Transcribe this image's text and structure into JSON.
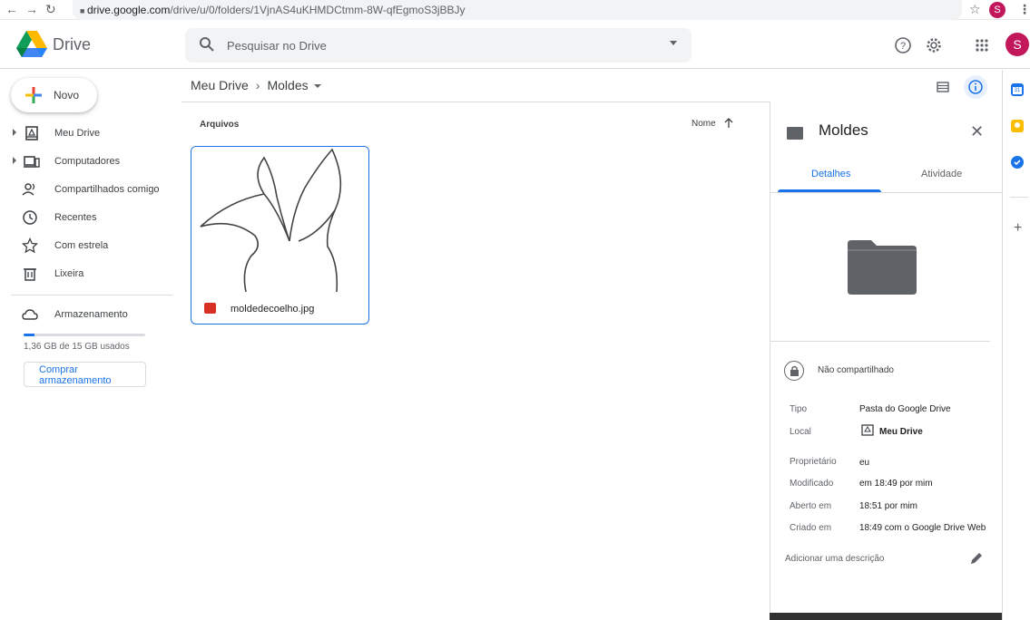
{
  "browser": {
    "url_host": "drive.google.com",
    "url_path": "/drive/u/0/folders/1VjnAS4uKHMDCtmm-8W-qfEgmoS3jBBJy",
    "avatar_letter": "S"
  },
  "header": {
    "brand": "Drive",
    "search_placeholder": "Pesquisar no Drive",
    "avatar_letter": "S"
  },
  "sidebar": {
    "new_label": "Novo",
    "items": [
      {
        "label": "Meu Drive",
        "icon": "drive-icon",
        "expandable": true
      },
      {
        "label": "Computadores",
        "icon": "computer-icon",
        "expandable": true
      },
      {
        "label": "Compartilhados comigo",
        "icon": "shared-icon",
        "expandable": false
      },
      {
        "label": "Recentes",
        "icon": "clock-icon",
        "expandable": false
      },
      {
        "label": "Com estrela",
        "icon": "star-icon",
        "expandable": false
      },
      {
        "label": "Lixeira",
        "icon": "trash-icon",
        "expandable": false
      }
    ],
    "storage_label": "Armazenamento",
    "storage_used_text": "1,36 GB de 15 GB usados",
    "storage_fraction": 0.09,
    "buy_storage_label": "Comprar armazenamento"
  },
  "main": {
    "breadcrumb_root": "Meu Drive",
    "breadcrumb_current": "Moldes",
    "section_title": "Arquivos",
    "sort_label": "Nome",
    "files": [
      {
        "name": "moldedecoelho.jpg",
        "type": "image"
      }
    ]
  },
  "details": {
    "title": "Moldes",
    "tab_details": "Detalhes",
    "tab_activity": "Atividade",
    "sharing": "Não compartilhado",
    "props": {
      "tipo_k": "Tipo",
      "tipo_v": "Pasta do Google Drive",
      "local_k": "Local",
      "local_v": "Meu Drive",
      "owner_k": "Proprietário",
      "owner_v": "eu",
      "modified_k": "Modificado",
      "modified_v": "em 18:49 por mim",
      "opened_k": "Aberto em",
      "opened_v": "18:51 por mim",
      "created_k": "Criado em",
      "created_v": "18:49 com o Google Drive Web"
    },
    "add_description": "Adicionar uma descrição"
  },
  "colors": {
    "accent": "#1a73e8",
    "avatar": "#c2185b",
    "folder": "#5f6368"
  }
}
